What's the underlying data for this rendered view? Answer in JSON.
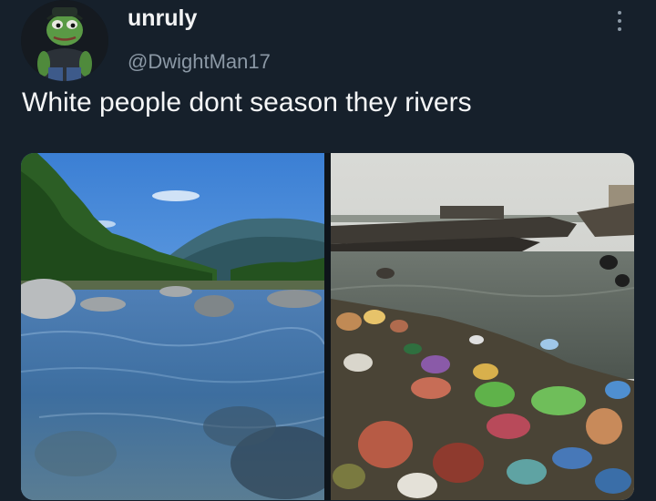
{
  "author": {
    "display_name": "unruly",
    "handle": "@DwightMan17"
  },
  "tweet": {
    "text": "White people dont season they rivers"
  },
  "media": {
    "photos": [
      {
        "subject": "clear-river-photo"
      },
      {
        "subject": "polluted-river-photo"
      }
    ]
  },
  "colors": {
    "background": "#16202b",
    "text_primary": "#f5f6f7",
    "text_secondary": "#8b98a5"
  },
  "icons": {
    "more": "more-options-icon"
  }
}
